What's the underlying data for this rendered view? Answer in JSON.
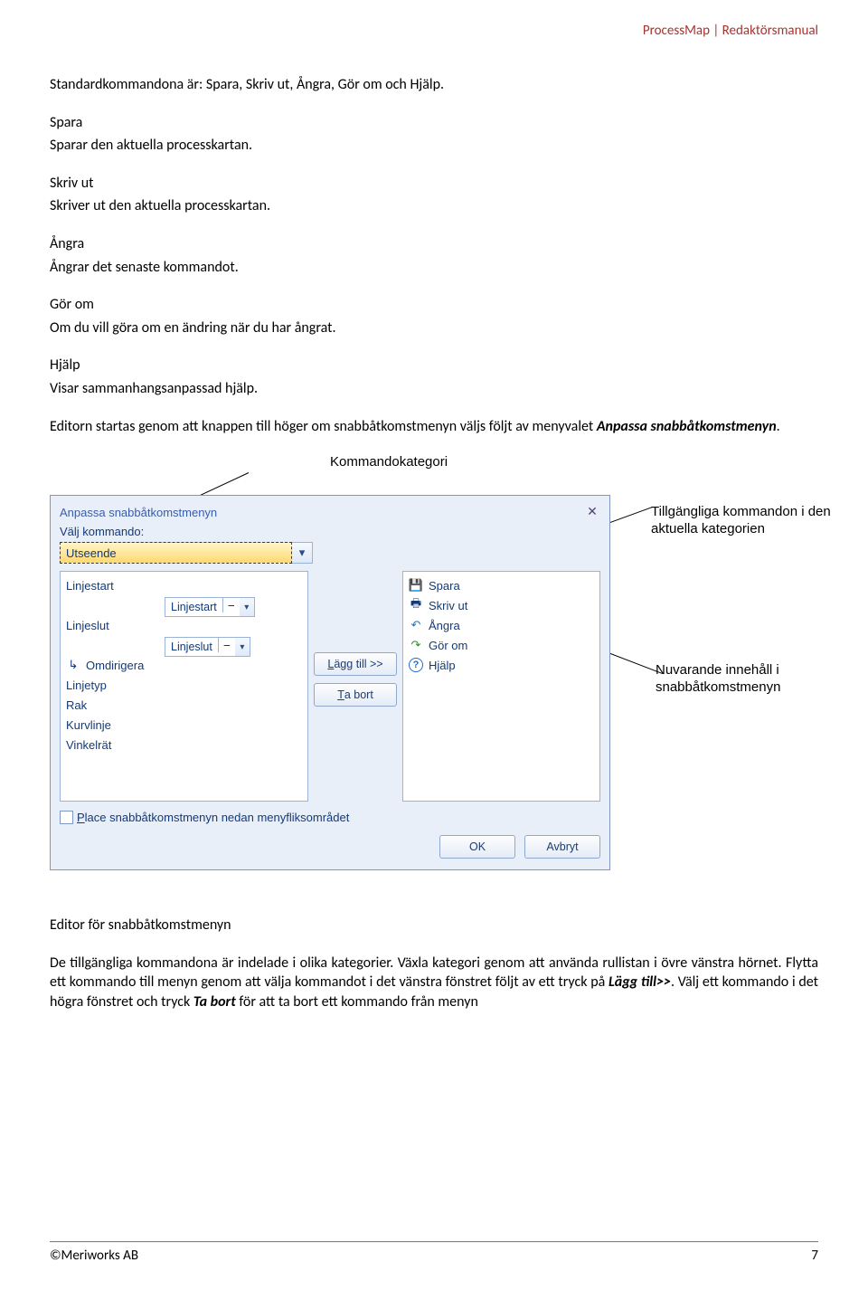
{
  "header": {
    "title": "ProcessMap | Redaktörsmanual"
  },
  "intro": "Standardkommandona är: Spara, Skriv ut, Ångra, Gör om och Hjälp.",
  "commands": {
    "spara": {
      "name": "Spara",
      "desc": "Sparar den aktuella processkartan."
    },
    "skrivut": {
      "name": "Skriv ut",
      "desc": "Skriver ut den aktuella processkartan."
    },
    "angra": {
      "name": "Ångra",
      "desc": "Ångrar det senaste kommandot."
    },
    "gorom": {
      "name": "Gör om",
      "desc": "Om du vill göra om en ändring när du har ångrat."
    },
    "hjalp": {
      "name": "Hjälp",
      "desc": "Visar sammanhangsanpassad hjälp."
    }
  },
  "editor_intro_1": "Editorn startas genom att knappen till höger om snabbåtkomstmenyn väljs följt av menyvalet ",
  "editor_intro_em": "Anpassa snabbåtkomstmenyn",
  "editor_intro_2": ".",
  "callouts": {
    "cat": "Kommandokategori",
    "avail": "Tillgängliga kommandon i den aktuella kategorien",
    "current": "Nuvarande innehåll i snabbåtkomstmenyn"
  },
  "dialog": {
    "title": "Anpassa snabbåtkomstmenyn",
    "label_choose": "Välj kommando:",
    "selected_category": "Utseende",
    "left_items": [
      "Linjestart",
      "Linjeslut",
      "Omdirigera",
      "Linjetyp",
      "Rak",
      "Kurvlinje",
      "Vinkelrät"
    ],
    "sub_linjestart": "Linjestart",
    "sub_linjeslut": "Linjeslut",
    "right_items": [
      {
        "icon": "save-icon",
        "glyph": "💾",
        "label": "Spara"
      },
      {
        "icon": "print-icon",
        "glyph": "🖶",
        "label": "Skriv ut"
      },
      {
        "icon": "undo-icon",
        "glyph": "↶",
        "label": "Ångra"
      },
      {
        "icon": "redo-icon",
        "glyph": "↷",
        "label": "Gör om"
      },
      {
        "icon": "help-icon",
        "glyph": "?",
        "label": "Hjälp"
      }
    ],
    "btn_add": "Lägg till >>",
    "btn_remove": "Ta bort",
    "checkbox_label": "Place snabbåtkomstmenyn nedan menyfliksområdet",
    "btn_ok": "OK",
    "btn_cancel": "Avbryt"
  },
  "caption": "Editor för snabbåtkomstmenyn",
  "para2": {
    "t1": "De tillgängliga kommandona är indelade i olika kategorier. Växla kategori genom att använda rullistan i övre vänstra hörnet. Flytta ett kommando till menyn genom att välja kommandot i det vänstra fönstret följt av ett tryck på ",
    "em1": "Lägg till>>",
    "t2": ". Välj ett kommando i det högra fönstret och tryck ",
    "em2": "Ta bort",
    "t3": " för att ta bort ett kommando från menyn"
  },
  "footer": {
    "left": "©Meriworks AB",
    "right": "7"
  }
}
